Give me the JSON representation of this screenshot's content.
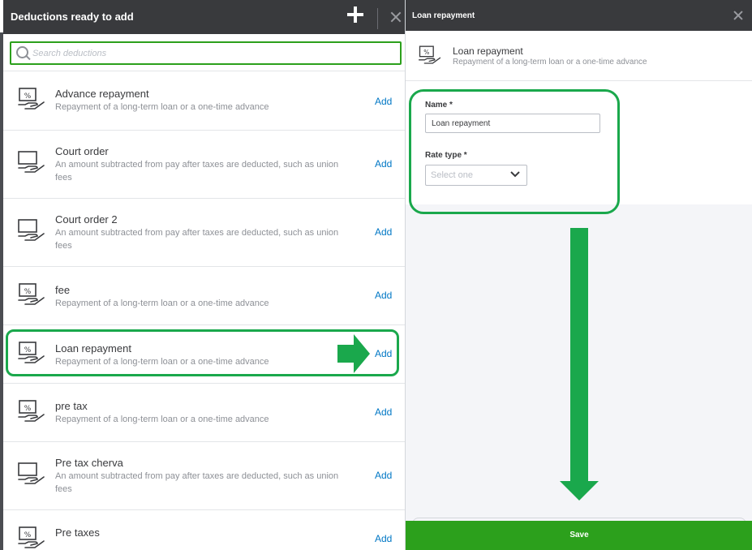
{
  "left_panel": {
    "title": "Deductions ready to add",
    "search": {
      "placeholder": "Search deductions"
    },
    "add_label": "Add",
    "items": [
      {
        "name": "Advance repayment",
        "desc": "Repayment of a long-term loan or a one-time advance",
        "icon": "loan-hand-icon"
      },
      {
        "name": "Court order",
        "desc": "An amount subtracted from pay after taxes are deducted, such as union fees",
        "icon": "monitor-hand-icon"
      },
      {
        "name": "Court order 2",
        "desc": "An amount subtracted from pay after taxes are deducted, such as union fees",
        "icon": "monitor-hand-icon"
      },
      {
        "name": "fee",
        "desc": "Repayment of a long-term loan or a one-time advance",
        "icon": "loan-hand-icon"
      },
      {
        "name": "Loan repayment",
        "desc": "Repayment of a long-term loan or a one-time advance",
        "icon": "loan-hand-icon"
      },
      {
        "name": "pre tax",
        "desc": "Repayment of a long-term loan or a one-time advance",
        "icon": "loan-hand-icon"
      },
      {
        "name": "Pre tax cherva",
        "desc": "An amount subtracted from pay after taxes are deducted, such as union fees",
        "icon": "monitor-hand-icon"
      },
      {
        "name": "Pre taxes",
        "desc": "",
        "icon": "loan-hand-icon"
      }
    ]
  },
  "right_panel": {
    "title": "Loan repayment",
    "summary": {
      "name": "Loan repayment",
      "desc": "Repayment of a long-term loan or a one-time advance"
    },
    "form": {
      "name_label": "Name *",
      "name_value": "Loan repayment",
      "rate_label": "Rate type *",
      "rate_placeholder": "Select one"
    },
    "save_label": "Save"
  },
  "colors": {
    "header_bg": "#393a3d",
    "accent_green": "#2ca01c",
    "annotation_green": "#1aa84c",
    "link_blue": "#0077c5"
  }
}
